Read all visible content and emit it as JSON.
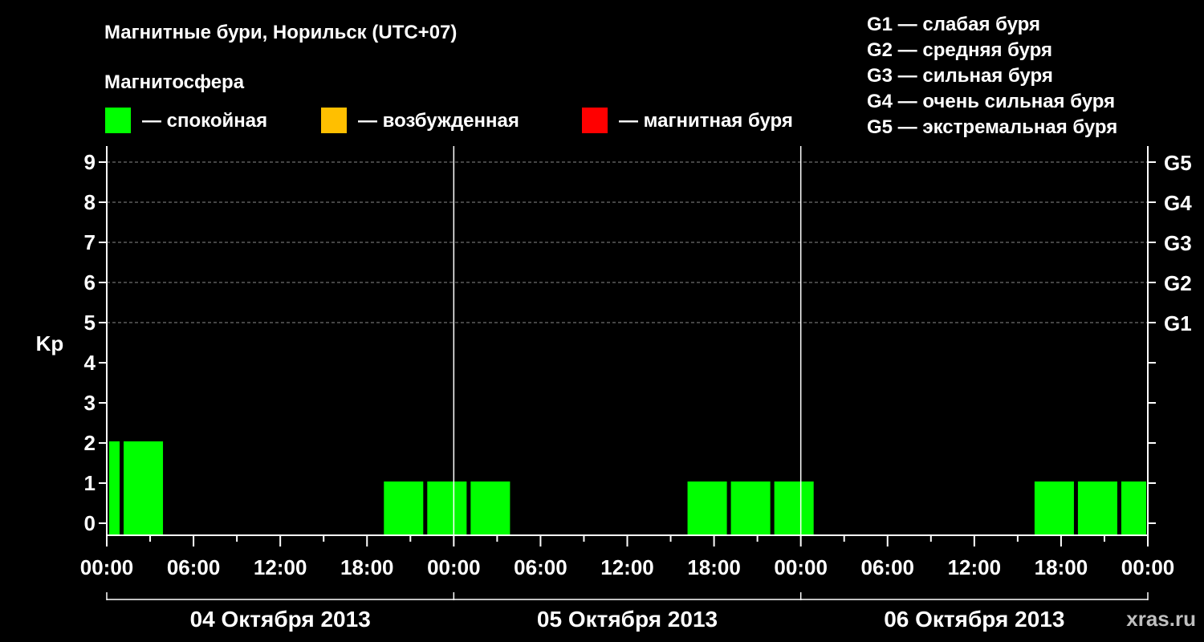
{
  "chart_data": {
    "type": "bar",
    "title": "Магнитные бури, Норильск (UTC+07)",
    "subtitle": "Магнитосфера",
    "ylabel": "Kp",
    "ylim": [
      0,
      9
    ],
    "yticks": [
      "0",
      "1",
      "2",
      "3",
      "4",
      "5",
      "6",
      "7",
      "8",
      "9"
    ],
    "right_axis": [
      {
        "level": 5,
        "label": "G1"
      },
      {
        "level": 6,
        "label": "G2"
      },
      {
        "level": 7,
        "label": "G3"
      },
      {
        "level": 8,
        "label": "G4"
      },
      {
        "level": 9,
        "label": "G5"
      }
    ],
    "grid": "dashed horizontal at Kp 5-9",
    "x_start": "2013-10-04 00:00",
    "x_end": "2013-10-07 00:00",
    "xticks": [
      "00:00",
      "06:00",
      "12:00",
      "18:00",
      "00:00",
      "06:00",
      "12:00",
      "18:00",
      "00:00",
      "06:00",
      "12:00",
      "18:00",
      "00:00"
    ],
    "days": [
      "04 Октября 2013",
      "05 Октября 2013",
      "06 Октября 2013"
    ],
    "status_legend": [
      {
        "label": "— спокойная",
        "color": "#00ff00"
      },
      {
        "label": "— возбужденная",
        "color": "#ffbf00"
      },
      {
        "label": "— магнитная буря",
        "color": "#ff0000"
      }
    ],
    "g_legend": [
      "G1 — слабая буря",
      "G2 — средняя буря",
      "G3 — сильная буря",
      "G4 — очень сильная буря",
      "G5 — экстремальная буря"
    ],
    "bars": [
      {
        "start": "2013-10-04 00:00",
        "end": "2013-10-04 01:00",
        "kp": 2,
        "status": "спокойная"
      },
      {
        "start": "2013-10-04 01:00",
        "end": "2013-10-04 04:00",
        "kp": 2,
        "status": "спокойная"
      },
      {
        "start": "2013-10-04 19:00",
        "end": "2013-10-04 22:00",
        "kp": 1,
        "status": "спокойная"
      },
      {
        "start": "2013-10-04 22:00",
        "end": "2013-10-05 01:00",
        "kp": 1,
        "status": "спокойная"
      },
      {
        "start": "2013-10-05 01:00",
        "end": "2013-10-05 04:00",
        "kp": 1,
        "status": "спокойная"
      },
      {
        "start": "2013-10-05 16:00",
        "end": "2013-10-05 19:00",
        "kp": 1,
        "status": "спокойная"
      },
      {
        "start": "2013-10-05 19:00",
        "end": "2013-10-05 22:00",
        "kp": 1,
        "status": "спокойная"
      },
      {
        "start": "2013-10-05 22:00",
        "end": "2013-10-06 01:00",
        "kp": 1,
        "status": "спокойная"
      },
      {
        "start": "2013-10-06 16:00",
        "end": "2013-10-06 19:00",
        "kp": 1,
        "status": "спокойная"
      },
      {
        "start": "2013-10-06 19:00",
        "end": "2013-10-06 22:00",
        "kp": 1,
        "status": "спокойная"
      },
      {
        "start": "2013-10-06 22:00",
        "end": "2013-10-07 00:00",
        "kp": 1,
        "status": "спокойная"
      }
    ]
  },
  "watermark": "xras.ru"
}
